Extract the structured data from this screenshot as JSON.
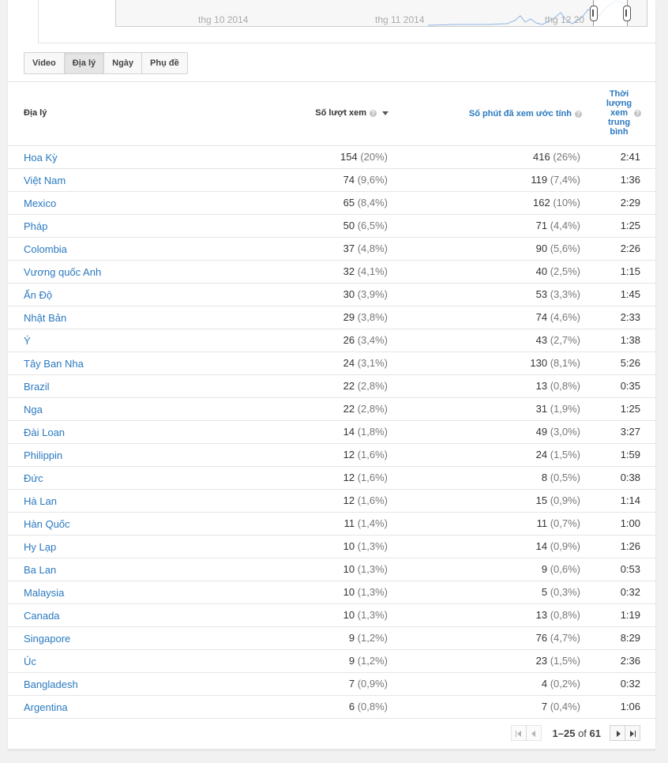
{
  "timeline": {
    "labels": [
      "thg 10 2014",
      "thg 11 2014",
      "thg 12 20"
    ]
  },
  "tabs": [
    {
      "label": "Video",
      "active": false
    },
    {
      "label": "Địa lý",
      "active": true
    },
    {
      "label": "Ngày",
      "active": false
    },
    {
      "label": "Phụ đề",
      "active": false
    }
  ],
  "table": {
    "headers": {
      "geography": "Địa lý",
      "views": "Số lượt xem",
      "minutes": "Số phút đã xem ước tính",
      "avg_duration": "Thời lượng xem trung bình"
    },
    "rows": [
      {
        "country": "Hoa Kỳ",
        "views": "154",
        "views_pct": "(20%)",
        "minutes": "416",
        "minutes_pct": "(26%)",
        "avg": "2:41"
      },
      {
        "country": "Việt Nam",
        "views": "74",
        "views_pct": "(9,6%)",
        "minutes": "119",
        "minutes_pct": "(7,4%)",
        "avg": "1:36"
      },
      {
        "country": "Mexico",
        "views": "65",
        "views_pct": "(8,4%)",
        "minutes": "162",
        "minutes_pct": "(10%)",
        "avg": "2:29"
      },
      {
        "country": "Pháp",
        "views": "50",
        "views_pct": "(6,5%)",
        "minutes": "71",
        "minutes_pct": "(4,4%)",
        "avg": "1:25"
      },
      {
        "country": "Colombia",
        "views": "37",
        "views_pct": "(4,8%)",
        "minutes": "90",
        "minutes_pct": "(5,6%)",
        "avg": "2:26"
      },
      {
        "country": "Vương quốc Anh",
        "views": "32",
        "views_pct": "(4,1%)",
        "minutes": "40",
        "minutes_pct": "(2,5%)",
        "avg": "1:15"
      },
      {
        "country": "Ấn Độ",
        "views": "30",
        "views_pct": "(3,9%)",
        "minutes": "53",
        "minutes_pct": "(3,3%)",
        "avg": "1:45"
      },
      {
        "country": "Nhật Bản",
        "views": "29",
        "views_pct": "(3,8%)",
        "minutes": "74",
        "minutes_pct": "(4,6%)",
        "avg": "2:33"
      },
      {
        "country": "Ý",
        "views": "26",
        "views_pct": "(3,4%)",
        "minutes": "43",
        "minutes_pct": "(2,7%)",
        "avg": "1:38"
      },
      {
        "country": "Tây Ban Nha",
        "views": "24",
        "views_pct": "(3,1%)",
        "minutes": "130",
        "minutes_pct": "(8,1%)",
        "avg": "5:26"
      },
      {
        "country": "Brazil",
        "views": "22",
        "views_pct": "(2,8%)",
        "minutes": "13",
        "minutes_pct": "(0,8%)",
        "avg": "0:35"
      },
      {
        "country": "Nga",
        "views": "22",
        "views_pct": "(2,8%)",
        "minutes": "31",
        "minutes_pct": "(1,9%)",
        "avg": "1:25"
      },
      {
        "country": "Đài Loan",
        "views": "14",
        "views_pct": "(1,8%)",
        "minutes": "49",
        "minutes_pct": "(3,0%)",
        "avg": "3:27"
      },
      {
        "country": "Philippin",
        "views": "12",
        "views_pct": "(1,6%)",
        "minutes": "24",
        "minutes_pct": "(1,5%)",
        "avg": "1:59"
      },
      {
        "country": "Đức",
        "views": "12",
        "views_pct": "(1,6%)",
        "minutes": "8",
        "minutes_pct": "(0,5%)",
        "avg": "0:38"
      },
      {
        "country": "Hà Lan",
        "views": "12",
        "views_pct": "(1,6%)",
        "minutes": "15",
        "minutes_pct": "(0,9%)",
        "avg": "1:14"
      },
      {
        "country": "Hàn Quốc",
        "views": "11",
        "views_pct": "(1,4%)",
        "minutes": "11",
        "minutes_pct": "(0,7%)",
        "avg": "1:00"
      },
      {
        "country": "Hy Lạp",
        "views": "10",
        "views_pct": "(1,3%)",
        "minutes": "14",
        "minutes_pct": "(0,9%)",
        "avg": "1:26"
      },
      {
        "country": "Ba Lan",
        "views": "10",
        "views_pct": "(1,3%)",
        "minutes": "9",
        "minutes_pct": "(0,6%)",
        "avg": "0:53"
      },
      {
        "country": "Malaysia",
        "views": "10",
        "views_pct": "(1,3%)",
        "minutes": "5",
        "minutes_pct": "(0,3%)",
        "avg": "0:32"
      },
      {
        "country": "Canada",
        "views": "10",
        "views_pct": "(1,3%)",
        "minutes": "13",
        "minutes_pct": "(0,8%)",
        "avg": "1:19"
      },
      {
        "country": "Singapore",
        "views": "9",
        "views_pct": "(1,2%)",
        "minutes": "76",
        "minutes_pct": "(4,7%)",
        "avg": "8:29"
      },
      {
        "country": "Úc",
        "views": "9",
        "views_pct": "(1,2%)",
        "minutes": "23",
        "minutes_pct": "(1,5%)",
        "avg": "2:36"
      },
      {
        "country": "Bangladesh",
        "views": "7",
        "views_pct": "(0,9%)",
        "minutes": "4",
        "minutes_pct": "(0,2%)",
        "avg": "0:32"
      },
      {
        "country": "Argentina",
        "views": "6",
        "views_pct": "(0,8%)",
        "minutes": "7",
        "minutes_pct": "(0,4%)",
        "avg": "1:06"
      }
    ]
  },
  "pagination": {
    "range": "1–25",
    "of_label": "of",
    "total": "61"
  },
  "colors": {
    "link": "#2a79c0",
    "help_icon": "#c4c4c4"
  },
  "icons": {
    "help": "help-icon",
    "sort": "sort-desc-icon",
    "first": "first-page-icon",
    "prev": "prev-page-icon",
    "next": "next-page-icon",
    "last": "last-page-icon"
  }
}
